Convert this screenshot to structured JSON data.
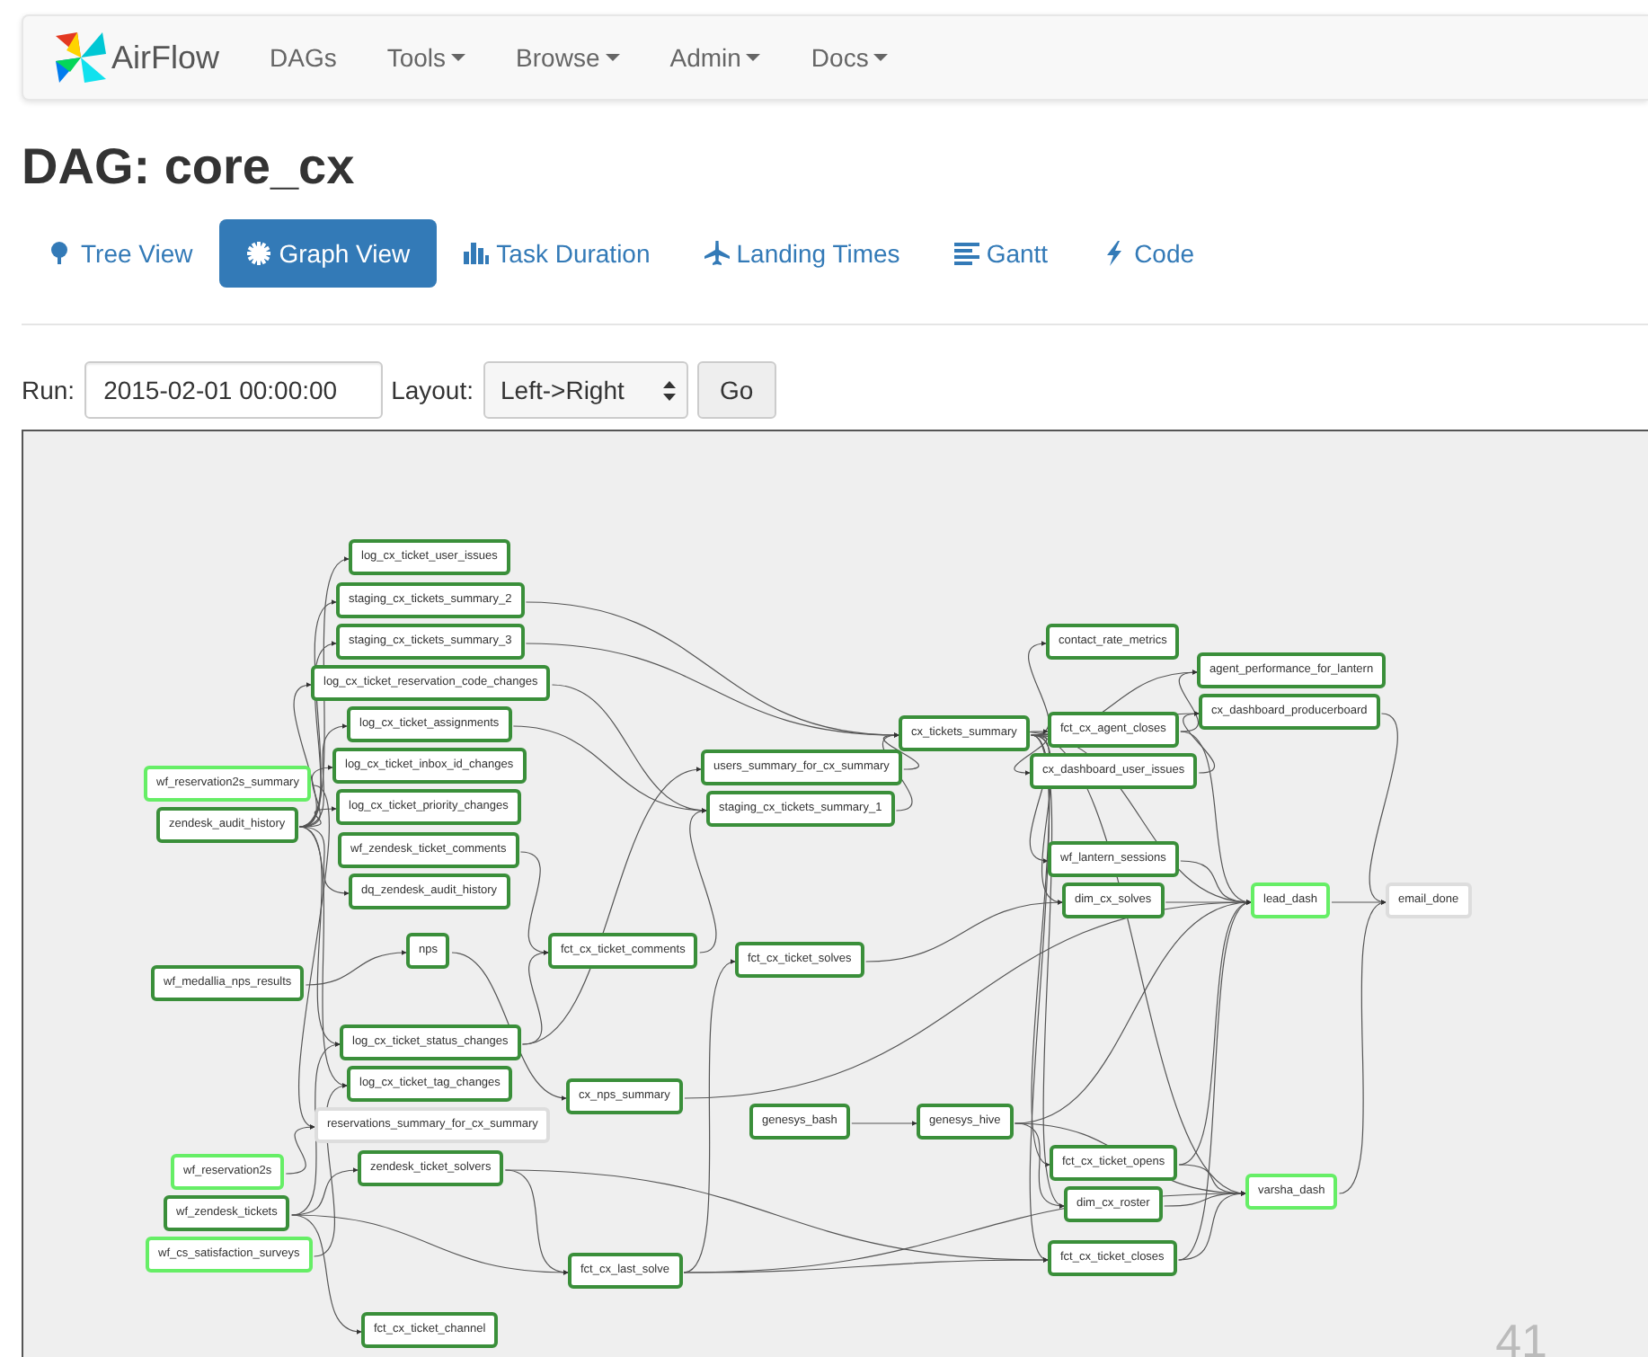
{
  "navbar": {
    "brand": "AirFlow",
    "items": [
      {
        "label": "DAGs",
        "dropdown": false
      },
      {
        "label": "Tools",
        "dropdown": true
      },
      {
        "label": "Browse",
        "dropdown": true
      },
      {
        "label": "Admin",
        "dropdown": true
      },
      {
        "label": "Docs",
        "dropdown": true
      }
    ]
  },
  "title": "DAG: core_cx",
  "tabs": [
    {
      "label": "Tree View",
      "selected": false
    },
    {
      "label": "Graph View",
      "selected": true
    },
    {
      "label": "Task Duration",
      "selected": false
    },
    {
      "label": "Landing Times",
      "selected": false
    },
    {
      "label": "Gantt",
      "selected": false
    },
    {
      "label": "Code",
      "selected": false
    }
  ],
  "form": {
    "run_label": "Run:",
    "run_value": "2015-02-01 00:00:00",
    "layout_label": "Layout:",
    "layout_value": "Left->Right",
    "button": "Go"
  },
  "graph": {
    "nodes": [
      {
        "label": "log_cx_ticket_user_issues",
        "color": "#3a8f3a"
      },
      {
        "label": "staging_cx_tickets_summary_2",
        "color": "#3a8f3a"
      },
      {
        "label": "staging_cx_tickets_summary_3",
        "color": "#3a8f3a"
      },
      {
        "label": "log_cx_ticket_reservation_code_changes",
        "color": "#3a8f3a"
      },
      {
        "label": "log_cx_ticket_assignments",
        "color": "#3a8f3a"
      },
      {
        "label": "log_cx_ticket_inbox_id_changes",
        "color": "#3a8f3a"
      },
      {
        "label": "wf_reservation2s_summary",
        "color": "#66ee66"
      },
      {
        "label": "zendesk_audit_history",
        "color": "#3a8f3a"
      },
      {
        "label": "log_cx_ticket_priority_changes",
        "color": "#3a8f3a"
      },
      {
        "label": "wf_zendesk_ticket_comments",
        "color": "#3a8f3a"
      },
      {
        "label": "dq_zendesk_audit_history",
        "color": "#3a8f3a"
      },
      {
        "label": "nps",
        "color": "#3a8f3a"
      },
      {
        "label": "fct_cx_ticket_comments",
        "color": "#3a8f3a"
      },
      {
        "label": "wf_medallia_nps_results",
        "color": "#3a8f3a"
      },
      {
        "label": "log_cx_ticket_status_changes",
        "color": "#3a8f3a"
      },
      {
        "label": "log_cx_ticket_tag_changes",
        "color": "#3a8f3a"
      },
      {
        "label": "reservations_summary_for_cx_summary",
        "color": "#dddddd"
      },
      {
        "label": "wf_reservation2s",
        "color": "#66ee66"
      },
      {
        "label": "zendesk_ticket_solvers",
        "color": "#3a8f3a"
      },
      {
        "label": "wf_zendesk_tickets",
        "color": "#3a8f3a"
      },
      {
        "label": "wf_cs_satisfaction_surveys",
        "color": "#66ee66"
      },
      {
        "label": "fct_cx_ticket_channel",
        "color": "#3a8f3a"
      },
      {
        "label": "users_summary_for_cx_summary",
        "color": "#3a8f3a"
      },
      {
        "label": "staging_cx_tickets_summary_1",
        "color": "#3a8f3a"
      },
      {
        "label": "fct_cx_ticket_solves",
        "color": "#3a8f3a"
      },
      {
        "label": "cx_nps_summary",
        "color": "#3a8f3a"
      },
      {
        "label": "genesys_bash",
        "color": "#3a8f3a"
      },
      {
        "label": "fct_cx_last_solve",
        "color": "#3a8f3a"
      },
      {
        "label": "cx_tickets_summary",
        "color": "#3a8f3a"
      },
      {
        "label": "contact_rate_metrics",
        "color": "#3a8f3a"
      },
      {
        "label": "agent_performance_for_lantern",
        "color": "#3a8f3a"
      },
      {
        "label": "fct_cx_agent_closes",
        "color": "#3a8f3a"
      },
      {
        "label": "cx_dashboard_producerboard",
        "color": "#3a8f3a"
      },
      {
        "label": "cx_dashboard_user_issues",
        "color": "#3a8f3a"
      },
      {
        "label": "wf_lantern_sessions",
        "color": "#3a8f3a"
      },
      {
        "label": "dim_cx_solves",
        "color": "#3a8f3a"
      },
      {
        "label": "lead_dash",
        "color": "#66ee66"
      },
      {
        "label": "email_done",
        "color": "#dddddd"
      },
      {
        "label": "genesys_hive",
        "color": "#3a8f3a"
      },
      {
        "label": "fct_cx_ticket_opens",
        "color": "#3a8f3a"
      },
      {
        "label": "dim_cx_roster",
        "color": "#3a8f3a"
      },
      {
        "label": "varsha_dash",
        "color": "#66ee66"
      },
      {
        "label": "fct_cx_ticket_closes",
        "color": "#3a8f3a"
      }
    ],
    "corner_number": "41"
  }
}
